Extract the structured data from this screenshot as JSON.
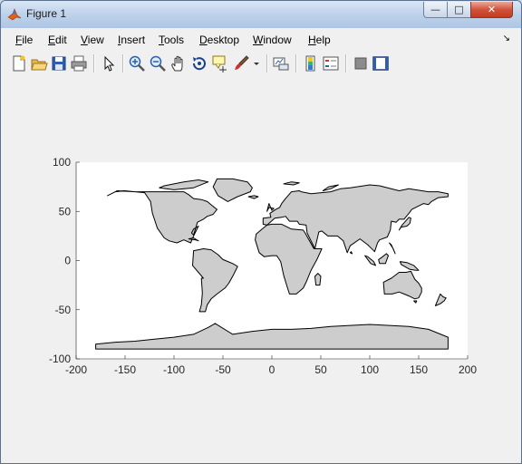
{
  "window": {
    "title": "Figure 1",
    "controls": {
      "minimize": "—",
      "maximize": "□",
      "close": "✕"
    }
  },
  "menubar": {
    "items": [
      {
        "label": "File",
        "underline": "F"
      },
      {
        "label": "Edit",
        "underline": "E"
      },
      {
        "label": "View",
        "underline": "V"
      },
      {
        "label": "Insert",
        "underline": "I"
      },
      {
        "label": "Tools",
        "underline": "T"
      },
      {
        "label": "Desktop",
        "underline": "D"
      },
      {
        "label": "Window",
        "underline": "W"
      },
      {
        "label": "Help",
        "underline": "H"
      }
    ],
    "dock_glyph": "↘"
  },
  "toolbar": {
    "buttons": [
      {
        "name": "new-figure-icon"
      },
      {
        "name": "open-file-icon"
      },
      {
        "name": "save-icon"
      },
      {
        "name": "print-icon"
      },
      {
        "name": "edit-plot-arrow-icon"
      },
      {
        "name": "zoom-in-icon"
      },
      {
        "name": "zoom-out-icon"
      },
      {
        "name": "pan-hand-icon"
      },
      {
        "name": "rotate-3d-icon"
      },
      {
        "name": "data-cursor-icon"
      },
      {
        "name": "brush-icon"
      },
      {
        "name": "link-plot-icon"
      },
      {
        "name": "colorbar-icon"
      },
      {
        "name": "legend-icon"
      },
      {
        "name": "hide-plot-tools-icon"
      },
      {
        "name": "show-plot-tools-icon"
      }
    ]
  },
  "chart_data": {
    "type": "map",
    "title": "",
    "xlabel": "",
    "ylabel": "",
    "xlim": [
      -200,
      200
    ],
    "ylim": [
      -100,
      100
    ],
    "xticks": [
      -200,
      -150,
      -100,
      -50,
      0,
      50,
      100,
      150,
      200
    ],
    "yticks": [
      100,
      50,
      0,
      -50,
      -100
    ],
    "grid": false,
    "land_color": "#cdcdcd",
    "coast_color": "#000000",
    "series": [
      {
        "region": "North America",
        "lon": [
          -168,
          -160,
          -150,
          -140,
          -130,
          -124,
          -122,
          -117,
          -110,
          -105,
          -97,
          -90,
          -83,
          -80,
          -75,
          -80,
          -82,
          -80,
          -76,
          -70,
          -66,
          -60,
          -56,
          -60,
          -66,
          -72,
          -80,
          -85,
          -90,
          -100,
          -110,
          -125,
          -140,
          -158,
          -168
        ],
        "lat": [
          66,
          70,
          71,
          70,
          69,
          60,
          48,
          33,
          23,
          20,
          18,
          21,
          18,
          25,
          35,
          32,
          28,
          26,
          39,
          42,
          45,
          47,
          52,
          55,
          60,
          62,
          63,
          67,
          70,
          70,
          70,
          70,
          70,
          71,
          66
        ]
      },
      {
        "region": "Greenland",
        "lon": [
          -56,
          -40,
          -25,
          -20,
          -22,
          -35,
          -45,
          -55,
          -60,
          -56
        ],
        "lat": [
          83,
          83,
          80,
          74,
          70,
          65,
          60,
          66,
          75,
          83
        ]
      },
      {
        "region": "South America",
        "lon": [
          -80,
          -75,
          -70,
          -62,
          -55,
          -50,
          -40,
          -35,
          -39,
          -44,
          -48,
          -56,
          -62,
          -66,
          -68,
          -74,
          -72,
          -71,
          -72,
          -70,
          -81,
          -80
        ],
        "lat": [
          10,
          11,
          12,
          11,
          6,
          1,
          -3,
          -6,
          -14,
          -23,
          -28,
          -34,
          -39,
          -45,
          -52,
          -52,
          -45,
          -33,
          -18,
          -18,
          -5,
          10
        ]
      },
      {
        "region": "Europe and Asia",
        "lon": [
          -9,
          -9,
          -1,
          -2,
          4,
          8,
          10,
          14,
          20,
          28,
          30,
          40,
          60,
          70,
          80,
          100,
          110,
          130,
          140,
          160,
          170,
          180,
          180,
          170,
          163,
          160,
          155,
          143,
          140,
          135,
          130,
          127,
          122,
          121,
          118,
          110,
          108,
          105,
          100,
          98,
          90,
          80,
          77,
          73,
          67,
          57,
          56,
          51,
          48,
          44,
          36,
          35,
          28,
          26,
          18,
          14,
          10,
          3,
          -5,
          -9
        ],
        "lat": [
          37,
          43,
          44,
          48,
          52,
          54,
          58,
          63,
          70,
          71,
          70,
          68,
          70,
          73,
          74,
          77,
          76,
          71,
          73,
          70,
          70,
          68,
          65,
          64,
          60,
          57,
          58,
          52,
          48,
          42,
          42,
          39,
          40,
          31,
          24,
          21,
          18,
          9,
          14,
          16,
          22,
          15,
          8,
          20,
          25,
          25,
          26,
          30,
          29,
          12,
          28,
          36,
          37,
          40,
          40,
          45,
          44,
          43,
          36,
          37
        ]
      },
      {
        "region": "Africa",
        "lon": [
          -17,
          -16,
          -10,
          -5,
          0,
          10,
          20,
          32,
          34,
          43,
          51,
          46,
          40,
          35,
          32,
          25,
          18,
          16,
          12,
          9,
          5,
          0,
          -8,
          -13,
          -17
        ],
        "lat": [
          21,
          27,
          32,
          36,
          37,
          37,
          32,
          31,
          28,
          12,
          12,
          1,
          -10,
          -22,
          -28,
          -34,
          -34,
          -28,
          -15,
          -1,
          5,
          5,
          4,
          8,
          21
        ]
      },
      {
        "region": "Australia",
        "lon": [
          114,
          122,
          130,
          137,
          142,
          146,
          150,
          153,
          153,
          150,
          146,
          140,
          135,
          130,
          123,
          115,
          114
        ],
        "lat": [
          -22,
          -18,
          -12,
          -12,
          -11,
          -19,
          -23,
          -28,
          -32,
          -38,
          -39,
          -36,
          -34,
          -32,
          -34,
          -34,
          -22
        ]
      },
      {
        "region": "Antarctica",
        "lon": [
          -180,
          -160,
          -140,
          -120,
          -100,
          -80,
          -65,
          -58,
          -40,
          -20,
          0,
          20,
          40,
          60,
          80,
          100,
          120,
          140,
          160,
          180,
          180,
          -180
        ],
        "lat": [
          -85,
          -83,
          -82,
          -80,
          -78,
          -75,
          -68,
          -64,
          -75,
          -72,
          -70,
          -70,
          -69,
          -67,
          -66,
          -65,
          -66,
          -67,
          -70,
          -78,
          -90,
          -90
        ]
      },
      {
        "region": "British Isles",
        "lon": [
          -5,
          -3,
          2,
          0,
          -3,
          -5
        ],
        "lat": [
          50,
          54,
          53,
          51,
          58,
          50
        ]
      },
      {
        "region": "Japan",
        "lon": [
          130,
          132,
          138,
          141,
          142,
          140,
          133,
          130
        ],
        "lat": [
          31,
          34,
          35,
          38,
          43,
          44,
          36,
          31
        ]
      },
      {
        "region": "Madagascar",
        "lon": [
          44,
          47,
          50,
          49,
          45,
          44
        ],
        "lat": [
          -16,
          -13,
          -16,
          -25,
          -25,
          -16
        ]
      },
      {
        "region": "Borneo",
        "lon": [
          109,
          112,
          117,
          119,
          116,
          110,
          109
        ],
        "lat": [
          1,
          3,
          7,
          5,
          -3,
          -3,
          1
        ]
      },
      {
        "region": "Sumatra",
        "lon": [
          95,
          98,
          104,
          106,
          101,
          95
        ],
        "lat": [
          5,
          4,
          -1,
          -5,
          -3,
          5
        ]
      },
      {
        "region": "New Guinea",
        "lon": [
          131,
          138,
          145,
          150,
          147,
          141,
          132,
          131
        ],
        "lat": [
          -1,
          -2,
          -5,
          -10,
          -10,
          -9,
          -4,
          -1
        ]
      },
      {
        "region": "New Zealand",
        "lon": [
          172,
          175,
          178,
          176,
          172,
          167,
          172
        ],
        "lat": [
          -34,
          -37,
          -38,
          -41,
          -44,
          -46,
          -34
        ]
      },
      {
        "region": "Arctic Islands",
        "lon": [
          -110,
          -90,
          -75,
          -65,
          -80,
          -100,
          -115,
          -110
        ],
        "lat": [
          76,
          80,
          82,
          80,
          74,
          72,
          74,
          76
        ]
      },
      {
        "region": "Cuba",
        "lon": [
          -85,
          -80,
          -75,
          -78,
          -85
        ],
        "lat": [
          22,
          23,
          20,
          21,
          22
        ]
      },
      {
        "region": "Iceland",
        "lon": [
          -24,
          -18,
          -14,
          -18,
          -24
        ],
        "lat": [
          65,
          66,
          65,
          63,
          65
        ]
      },
      {
        "region": "Svalbard",
        "lon": [
          12,
          20,
          28,
          22,
          12
        ],
        "lat": [
          78,
          80,
          79,
          77,
          78
        ]
      },
      {
        "region": "Novaya Zemlya",
        "lon": [
          52,
          58,
          68,
          60,
          52
        ],
        "lat": [
          71,
          75,
          77,
          73,
          71
        ]
      },
      {
        "region": "Sri Lanka",
        "lon": [
          80,
          81,
          82,
          80
        ],
        "lat": [
          8,
          9,
          7,
          8
        ]
      },
      {
        "region": "Philippines",
        "lon": [
          120,
          122,
          126,
          124,
          120
        ],
        "lat": [
          18,
          16,
          7,
          12,
          18
        ]
      },
      {
        "region": "Tasmania",
        "lon": [
          145,
          148,
          147,
          145
        ],
        "lat": [
          -41,
          -41,
          -43,
          -41
        ]
      }
    ]
  }
}
